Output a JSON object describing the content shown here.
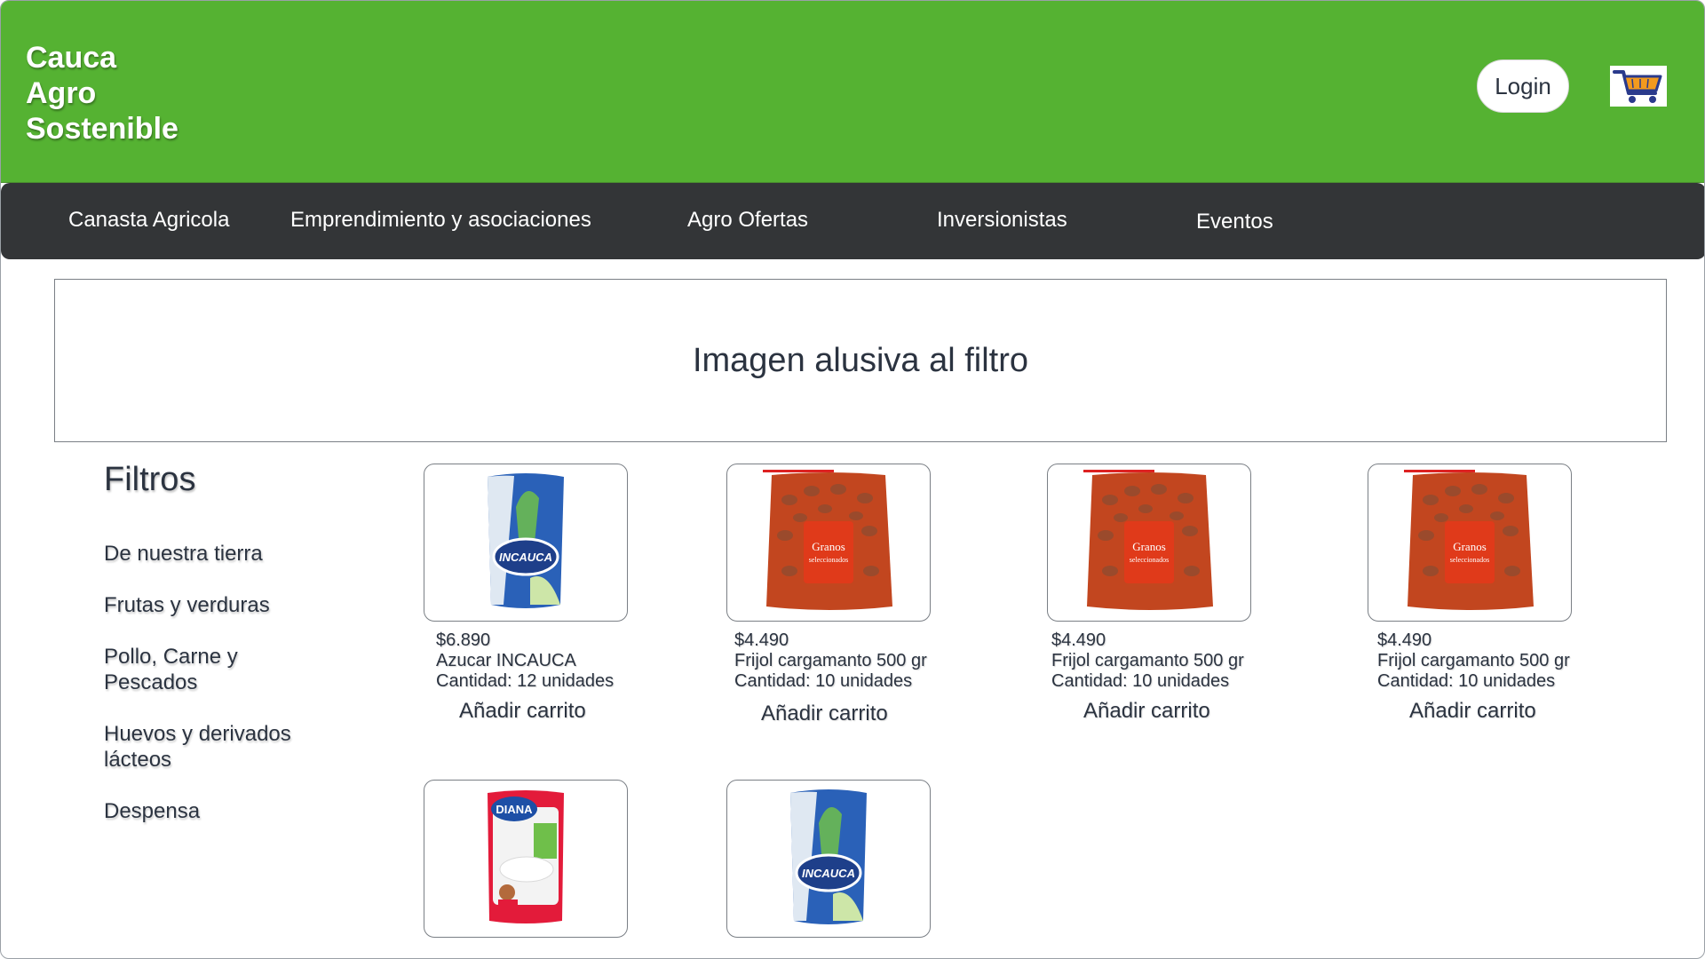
{
  "header": {
    "logo_lines": [
      "Cauca",
      "Agro",
      "Sostenible"
    ],
    "login_label": "Login",
    "cart_icon": "shopping-cart-icon",
    "brand_color": "#55b232"
  },
  "nav": {
    "items": [
      {
        "label": "Canasta Agricola"
      },
      {
        "label": "Emprendimiento y asociaciones"
      },
      {
        "label": "Agro Ofertas"
      },
      {
        "label": "Inversionistas"
      },
      {
        "label": "Eventos"
      }
    ]
  },
  "banner": {
    "text": "Imagen alusiva al filtro"
  },
  "filters": {
    "title": "Filtros",
    "items": [
      {
        "label": "De nuestra tierra"
      },
      {
        "label": "Frutas y verduras"
      },
      {
        "label": "Pollo, Carne y Pescados"
      },
      {
        "label": "Huevos y derivados lácteos"
      },
      {
        "label": "Despensa"
      }
    ]
  },
  "products": [
    {
      "price": "$6.890",
      "name": "Azucar INCAUCA",
      "quantity": "Cantidad: 12 unidades",
      "add_label": "Añadir carrito",
      "image": "sugar-bag-incauca"
    },
    {
      "price": "$4.490",
      "name": "Frijol cargamanto 500 gr",
      "quantity": "Cantidad: 10 unidades",
      "add_label": "Añadir carrito",
      "image": "beans-bag"
    },
    {
      "price": "$4.490",
      "name": "Frijol cargamanto 500 gr",
      "quantity": "Cantidad: 10 unidades",
      "add_label": "Añadir carrito",
      "image": "beans-bag"
    },
    {
      "price": "$4.490",
      "name": "Frijol cargamanto 500 gr",
      "quantity": "Cantidad: 10 unidades",
      "add_label": "Añadir carrito",
      "image": "beans-bag"
    },
    {
      "image": "rice-bag-diana"
    },
    {
      "image": "sugar-bag-incauca"
    }
  ],
  "product_image_labels": {
    "incauca": "INCAUCA",
    "granos": "Granos",
    "seleccionados": "seleccionados",
    "diana": "DIANA"
  }
}
